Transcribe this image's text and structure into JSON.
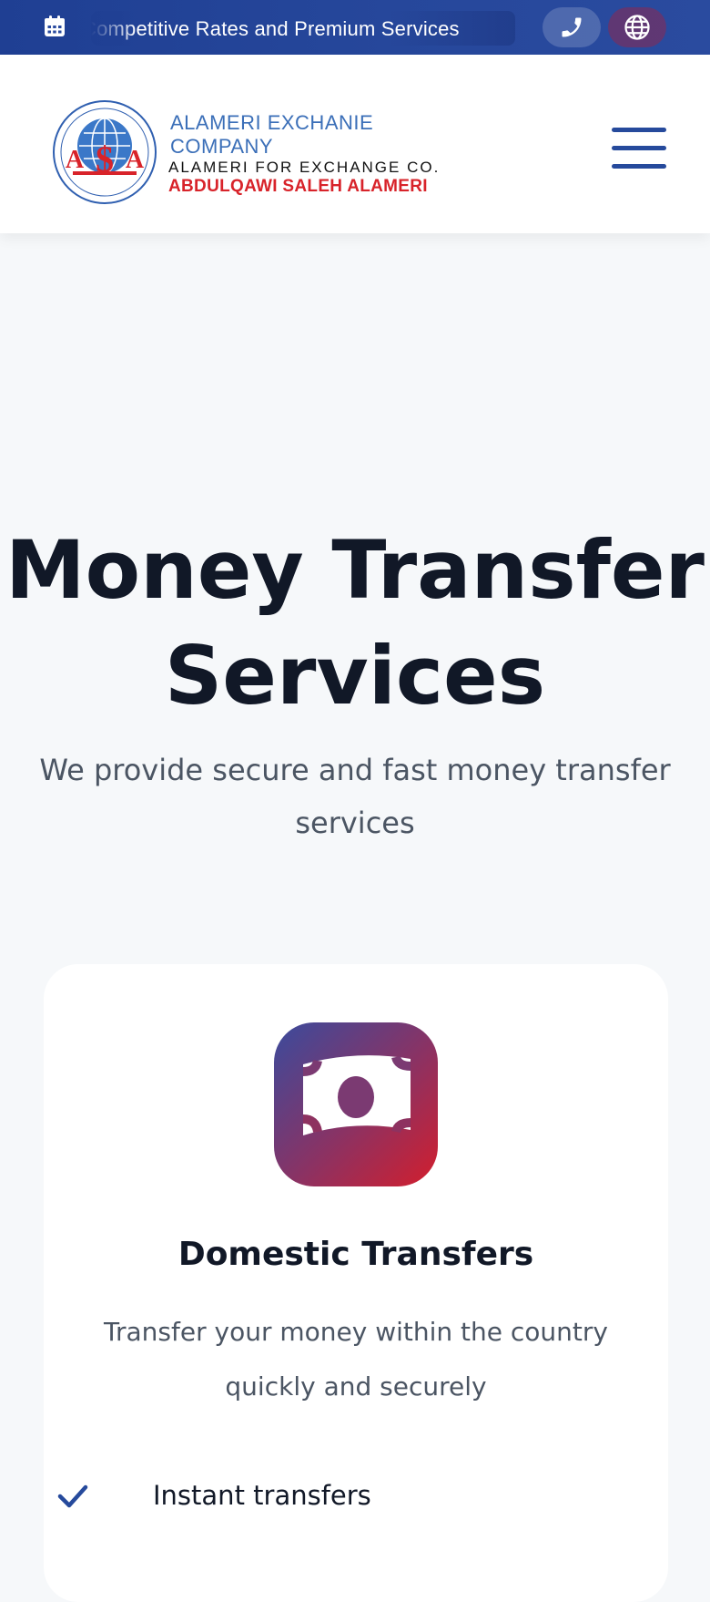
{
  "topbar": {
    "ticker_text": "Competitive Rates and Premium Services",
    "icons": {
      "calendar": "calendar-icon",
      "phone": "phone-icon",
      "globe": "globe-icon"
    }
  },
  "header": {
    "logo": {
      "line1": "ALAMERI EXCHANIE",
      "line2": "COMPANY",
      "line3": "ALAMERI FOR EXCHANGE CO.",
      "line4": "ABDULQAWI SALEH ALAMERI"
    },
    "menu_icon": "hamburger-menu-icon"
  },
  "hero": {
    "title": "Money Transfer Services",
    "subtitle": "We provide secure and fast money transfer services"
  },
  "service_card": {
    "icon": "banknote-icon",
    "title": "Domestic Transfers",
    "description": "Transfer your money within the country quickly and securely",
    "features": [
      "Instant transfers"
    ]
  },
  "colors": {
    "primary": "#264a9c",
    "accent_red": "#d31e2d",
    "text_dark": "#111827",
    "text_muted": "#4b5563",
    "background": "#f6f8fa"
  }
}
